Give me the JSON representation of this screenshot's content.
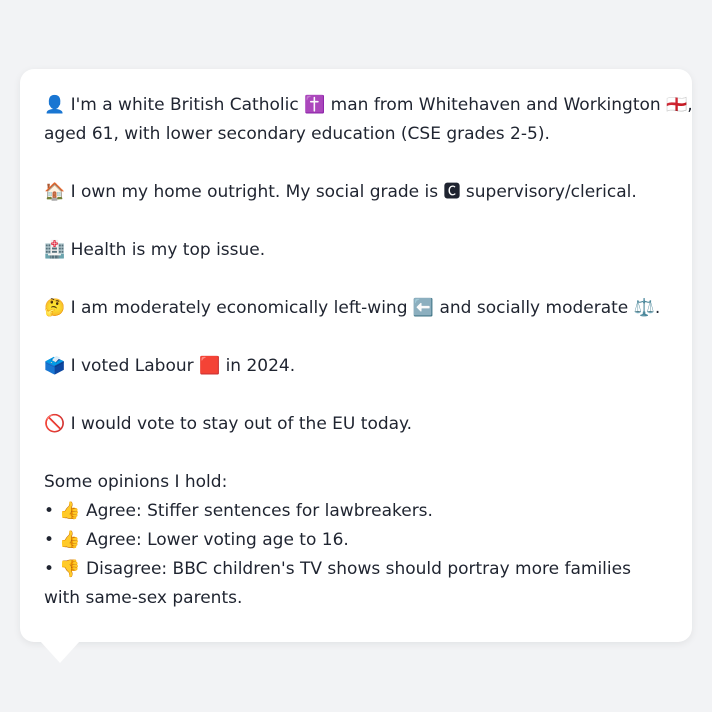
{
  "profile": {
    "p1a": "👤 I'm a white British Catholic ✝️ man from Whitehaven and Workington 🏴󠁧󠁢󠁥󠁮󠁧󠁿,",
    "p1b": "aged 61, with lower secondary education (CSE grades 2-5).",
    "p2": "🏠 I own my home outright. My social grade is 🅲 supervisory/clerical.",
    "p3": "🏥 Health is my top issue.",
    "p4": "🤔 I am moderately economically left-wing ⬅️ and socially moderate ⚖️.",
    "p5": "🗳️ I voted Labour 🟥 in 2024.",
    "p6": "🚫 I would vote to stay out of the EU today.",
    "opinions_heading": "Some opinions I hold:",
    "opinions": [
      "• 👍 Agree: Stiffer sentences for lawbreakers.",
      "• 👍 Agree: Lower voting age to 16.",
      "• 👎 Disagree: BBC children's TV shows should portray more families with same-sex parents."
    ]
  }
}
